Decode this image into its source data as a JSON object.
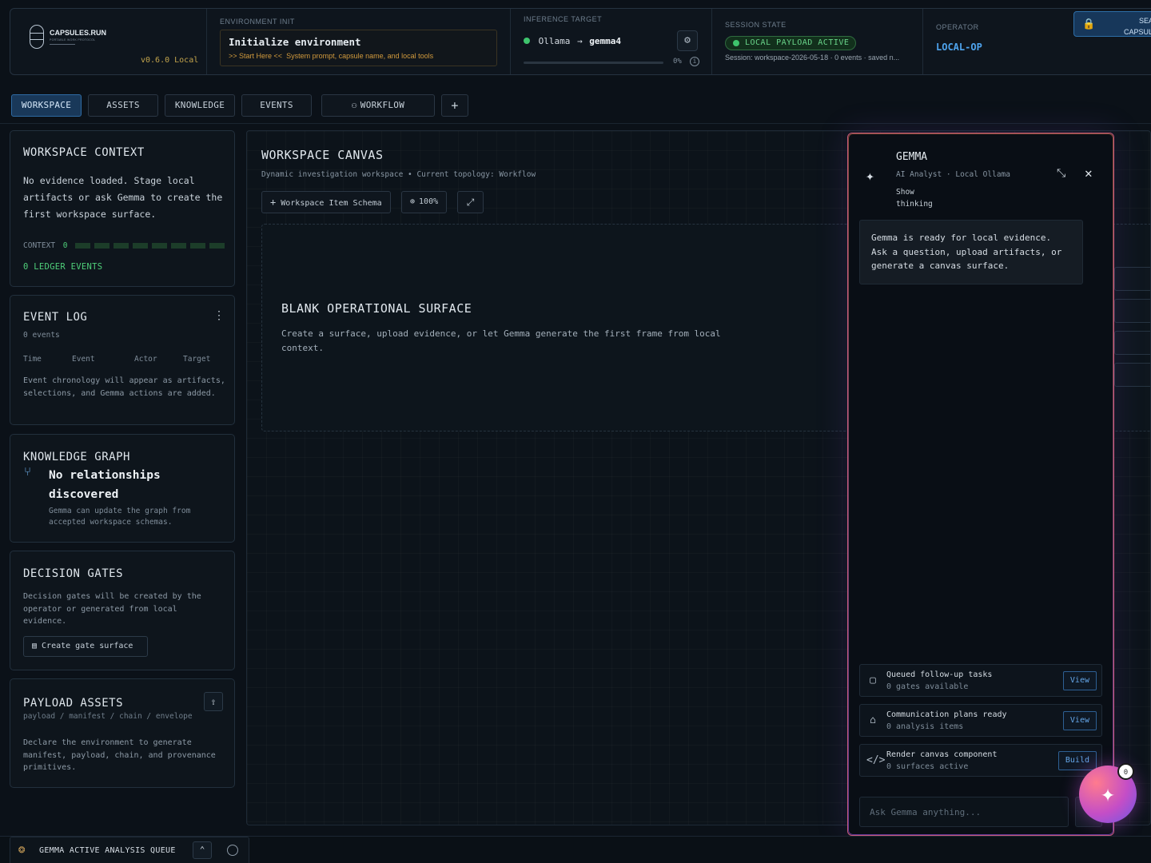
{
  "header": {
    "brand": {
      "name": "CAPSULES.RUN",
      "tagline": "PORTABLE WORK PROTOCOL",
      "version": "v0.6.0 Local"
    },
    "environment": {
      "label": "ENVIRONMENT INIT",
      "title": "Initialize environment",
      "hint_prefix": ">> Start Here <<",
      "hint": "System prompt, capsule name, and local tools"
    },
    "inference": {
      "label": "INFERENCE TARGET",
      "provider": "Ollama",
      "arrow": "→",
      "model": "gemma4",
      "progress": "0%",
      "progress_value": 0
    },
    "session": {
      "label": "SESSION STATE",
      "status": "LOCAL PAYLOAD ACTIVE",
      "detail": "Session: workspace-2026-05-18 · 0 events · saved n..."
    },
    "operator": {
      "label": "OPERATOR",
      "name": "LOCAL-OP"
    },
    "seal_button": "SEAL CAPSULE"
  },
  "tabs": [
    {
      "label": "WORKSPACE",
      "active": true
    },
    {
      "label": "ASSETS",
      "active": false
    },
    {
      "label": "KNOWLEDGE",
      "active": false
    },
    {
      "label": "EVENTS",
      "active": false
    },
    {
      "label": "WORKFLOW",
      "active": false
    },
    {
      "label": "+",
      "active": false
    }
  ],
  "sidebar": {
    "context": {
      "title": "WORKSPACE CONTEXT",
      "body": "No evidence loaded. Stage local artifacts or ask Gemma to create the first workspace surface.",
      "meter_label": "CONTEXT",
      "meter_value": "0",
      "ledger": "0 LEDGER EVENTS"
    },
    "event_log": {
      "title": "EVENT LOG",
      "count": "0 events",
      "columns": [
        "Time",
        "Event",
        "Actor",
        "Target"
      ],
      "empty": "Event chronology will appear as artifacts, selections, and Gemma actions are added."
    },
    "knowledge": {
      "title": "KNOWLEDGE GRAPH",
      "headline": "No relationships discovered",
      "body": "Gemma can update the graph from accepted workspace schemas."
    },
    "gates": {
      "title": "DECISION GATES",
      "body": "Decision gates will be created by the operator or generated from local evidence.",
      "button": "Create gate surface"
    },
    "assets": {
      "title": "PAYLOAD ASSETS",
      "path": "payload / manifest / chain / envelope",
      "body": "Declare the environment to generate manifest, payload, chain, and provenance primitives."
    }
  },
  "canvas": {
    "title": "WORKSPACE CANVAS",
    "subtitle": "Dynamic investigation workspace • Current topology: Workflow",
    "schema_button": "Workspace Item Schema",
    "zoom": "100%",
    "surface_title": "BLANK OPERATIONAL SURFACE",
    "surface_body": "Create a surface, upload evidence, or let Gemma generate the first frame from local context."
  },
  "gemma": {
    "name": "GEMMA",
    "role": "AI Analyst · Local Ollama",
    "thinking_toggle": "Show thinking",
    "message": "Gemma is ready for local evidence. Ask a question, upload artifacts, or generate a canvas surface.",
    "actions": [
      {
        "title": "Queued follow-up tasks",
        "sub": "0 gates available",
        "button": "View",
        "icon": "chat-icon"
      },
      {
        "title": "Communication plans ready",
        "sub": "0 analysis items",
        "button": "View",
        "icon": "robot-icon"
      },
      {
        "title": "Render canvas component",
        "sub": "0 surfaces active",
        "button": "Build",
        "icon": "code-icon"
      }
    ],
    "input_placeholder": "Ask Gemma anything...",
    "fab_badge": "0"
  },
  "footer": {
    "queue_label": "GEMMA ACTIVE ANALYSIS QUEUE"
  }
}
